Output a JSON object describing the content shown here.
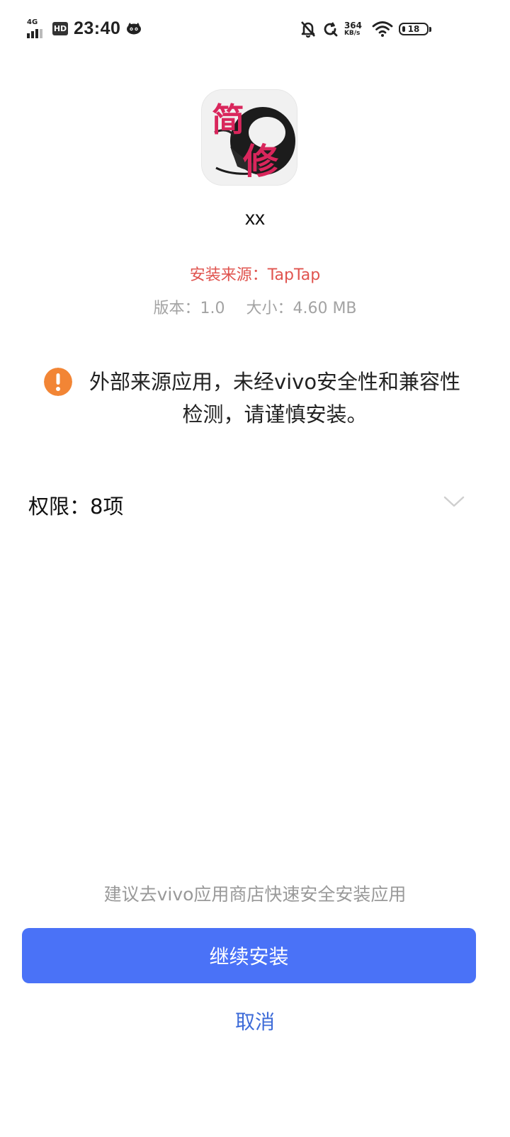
{
  "status_bar": {
    "network_label": "4G",
    "hd_label": "HD",
    "time": "23:40",
    "speed_value": "364",
    "speed_unit": "KB/s",
    "battery_level": "18",
    "icons": [
      "signal-icon",
      "hd-icon",
      "app-notification-face-icon",
      "mute-bell-icon",
      "sync-icon",
      "wifi-icon",
      "battery-icon"
    ]
  },
  "app": {
    "icon": "app-icon",
    "name": "xx",
    "source": "安装来源：TapTap",
    "version": "版本：1.0",
    "size": "大小：4.60 MB"
  },
  "warning": {
    "icon": "warning-icon",
    "color": "#f28535",
    "text": "外部来源应用，未经vivo安全性和兼容性检测，请谨慎安装。"
  },
  "permissions": {
    "label": "权限：8项",
    "icon": "chevron-down-icon"
  },
  "footer": {
    "suggestion": "建议去vivo应用商店快速安全安装应用",
    "continue_label": "继续安装",
    "cancel_label": "取消"
  },
  "colors": {
    "primary_button": "#4a72f7",
    "source_text": "#e0544f",
    "cancel_text": "#3d6bd8",
    "meta_text": "#a3a3a3"
  }
}
